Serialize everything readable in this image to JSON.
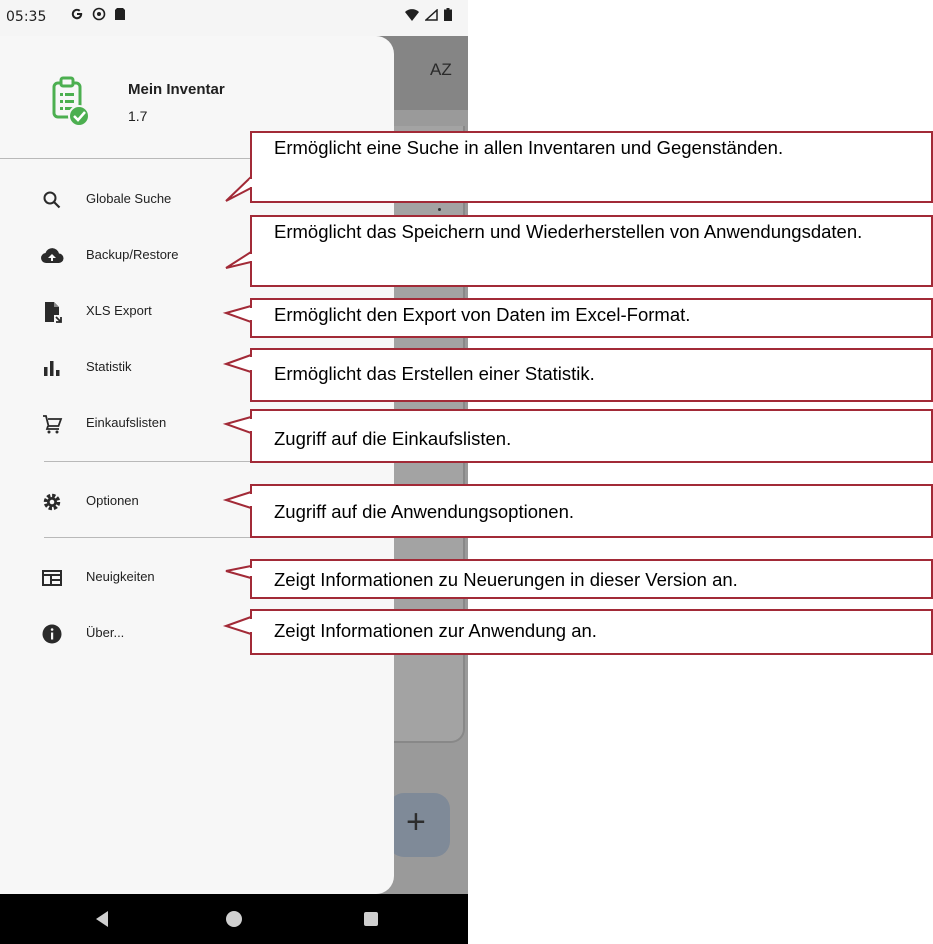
{
  "status_bar": {
    "time": "05:35",
    "left_icons": [
      "google-icon",
      "sync-icon",
      "sim-card-icon"
    ],
    "right_icons": [
      "wifi-icon",
      "signal-icon",
      "battery-icon"
    ]
  },
  "app_bar": {
    "sort_label": "AZ"
  },
  "drawer": {
    "app_name": "Mein Inventar",
    "version": "1.7",
    "items": [
      {
        "label": "Globale Suche",
        "icon": "search-icon"
      },
      {
        "label": "Backup/Restore",
        "icon": "cloud-upload-icon"
      },
      {
        "label": "XLS Export",
        "icon": "file-export-icon"
      },
      {
        "label": "Statistik",
        "icon": "bar-chart-icon"
      },
      {
        "label": "Einkaufslisten",
        "icon": "shopping-cart-icon"
      },
      {
        "label": "Optionen",
        "icon": "gear-icon"
      },
      {
        "label": "Neuigkeiten",
        "icon": "news-icon"
      },
      {
        "label": "Über...",
        "icon": "info-icon"
      }
    ]
  },
  "fab": {
    "label": "+"
  },
  "callouts": [
    "Ermöglicht eine Suche in allen Inventaren und Gegenständen.",
    "Ermöglicht das Speichern und Wiederherstellen von Anwendungsdaten.",
    "Ermöglicht den Export von Daten im Excel-Format.",
    "Ermöglicht das Erstellen einer Statistik.",
    "Zugriff auf die Einkaufslisten.",
    "Zugriff auf die Anwendungsoptionen.",
    "Zeigt Informationen zu Neuerungen in dieser Version an.",
    "Zeigt Informationen zur Anwendung an."
  ],
  "colors": {
    "callout_border": "#a22a37",
    "app_icon_green": "#4caf50"
  }
}
